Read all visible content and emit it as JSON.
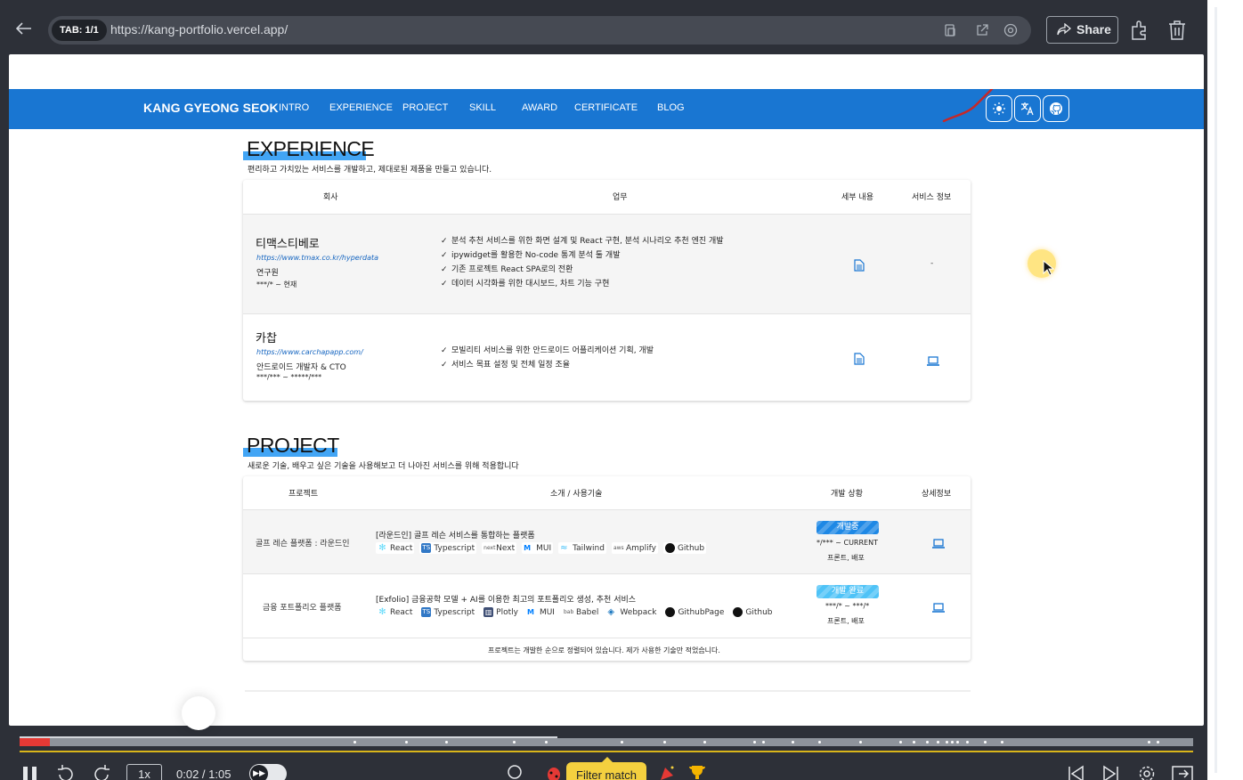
{
  "browser": {
    "tab_label": "TAB: 1/1",
    "url": "https://kang-portfolio.vercel.app/",
    "share_label": "Share"
  },
  "nav": {
    "brand": "KANG GYEONG SEOK",
    "links": [
      "INTRO",
      "EXPERIENCE",
      "PROJECT",
      "SKILL",
      "AWARD",
      "CERTIFICATE",
      "BLOG"
    ],
    "icons": [
      "sun-icon",
      "translate-icon",
      "github-icon"
    ]
  },
  "experience": {
    "title": "EXPERIENCE",
    "subtitle": "편리하고 가치있는 서비스를 개발하고, 제대로된 제품을 만들고 있습니다.",
    "headers": [
      "회사",
      "업무",
      "세부 내용",
      "서비스 정보"
    ],
    "rows": [
      {
        "company": "티맥스티베로",
        "link": "https://www.tmax.co.kr/hyperdata",
        "role": "연구원",
        "period": "***/* ~ 현재",
        "tasks": [
          "분석 추천 서비스를 위한 화면 설계 및 React 구현, 분석 시나리오 추천 엔진 개발",
          "ipywidget를 활용한 No-code 통계 분석 툴 개발",
          "기존 프로젝트 React SPA로의 전환",
          "데이터 시각화를 위한 대시보드, 차트 기능 구현"
        ],
        "service": "-"
      },
      {
        "company": "카찹",
        "link": "https://www.carchapapp.com/",
        "role": "안드로이드 개발자 & CTO",
        "period": "***/*** ~ *****/***",
        "tasks": [
          "모빌리티 서비스를 위한 안드로이드 어플리케이션 기획, 개발",
          "서비스 목표 설정 및 전체 일정 조율"
        ]
      }
    ]
  },
  "project": {
    "title": "PROJECT",
    "subtitle": "새로운 기술, 배우고 싶은 기술을 사용해보고 더 나아진 서비스를 위해 적용합니다",
    "headers": [
      "프로젝트",
      "소개 / 사용기술",
      "개발 상황",
      "상세정보"
    ],
    "rows": [
      {
        "name": "골프 레슨 플랫폼 : 라운드인",
        "desc": "[라운드인] 골프 레슨 서비스를 통합하는 플랫폼",
        "tech": [
          "React",
          "Typescript",
          "Next",
          "MUI",
          "Tailwind",
          "Amplify",
          "Github"
        ],
        "status": "개발중",
        "status_color": "#1e88e5",
        "period": "*/*** ~ CURRENT",
        "role": "프론트, 배포"
      },
      {
        "name": "금융 포트폴리오 플랫폼",
        "desc": "[Exfolio] 금융공학 모델 + AI를 이용한 최고의 포트폴리오 생성, 추천 서비스",
        "tech": [
          "React",
          "Typescript",
          "Plotly",
          "MUI",
          "Babel",
          "Webpack",
          "GithubPage",
          "Github"
        ],
        "status": "개발 완료",
        "status_color": "#4fc3f7",
        "period": "***/* ~ ***/*",
        "role": "프론트, 배포"
      }
    ],
    "footnote": "프로젝트는 개발한 순으로 정렬되어 있습니다. 제가 사용한 기술만 적었습니다."
  },
  "player": {
    "speed": "1x",
    "time": "0:02 / 1:05",
    "filter_label": "Filter match",
    "progress": 0.026
  }
}
